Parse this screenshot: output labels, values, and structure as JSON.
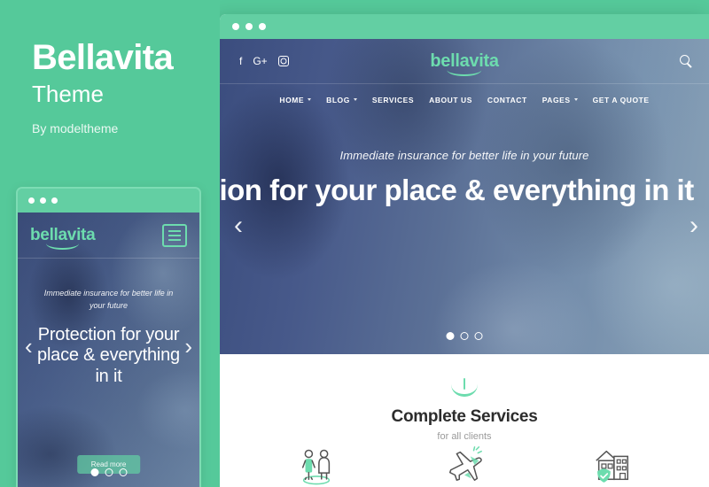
{
  "left_panel": {
    "brand_title": "Bellavita",
    "brand_subtitle": "Theme",
    "author": "By modeltheme"
  },
  "colors": {
    "brand_green": "#55c99a",
    "titlebar_green": "#63cfa3",
    "logo_green": "#6ddcae",
    "hero_navy": "#3b4d7e",
    "heading_dark": "#2c2c2c",
    "muted_gray": "#9a9a9a"
  },
  "mobile_mockup": {
    "window_dots": [
      "dot",
      "dot",
      "dot"
    ],
    "logo": "bellavita",
    "menu_icon": "hamburger-icon",
    "tagline": "Immediate insurance for better life in your future",
    "heading": "Protection for your place & everything in it",
    "cta_label": "Read more",
    "prev_arrow": "‹",
    "next_arrow": "›",
    "carousel_dots": 3,
    "active_dot": 0
  },
  "desktop_mockup": {
    "window_dots": [
      "dot",
      "dot",
      "dot"
    ],
    "logo": "bellavita",
    "search_icon": "search-icon",
    "social": [
      {
        "name": "facebook-icon",
        "glyph": "f"
      },
      {
        "name": "google-plus-icon",
        "glyph": "G+"
      },
      {
        "name": "instagram-icon",
        "glyph": ""
      }
    ],
    "nav": [
      {
        "label": "HOME",
        "has_dropdown": true
      },
      {
        "label": "BLOG",
        "has_dropdown": true
      },
      {
        "label": "SERVICES",
        "has_dropdown": false
      },
      {
        "label": "ABOUT US",
        "has_dropdown": false
      },
      {
        "label": "CONTACT",
        "has_dropdown": false
      },
      {
        "label": "PAGES",
        "has_dropdown": true
      },
      {
        "label": "GET A QUOTE",
        "has_dropdown": false
      }
    ],
    "tagline": "Immediate insurance for better life in your future",
    "heading": "Protection for your place & everything in it",
    "prev_arrow": "‹",
    "next_arrow": "›",
    "carousel_dots": 3,
    "active_dot": 0
  },
  "services": {
    "icon": "umbrella-icon",
    "title": "Complete Services",
    "subtitle": "for all clients",
    "cards": [
      {
        "icon": "family-people-icon"
      },
      {
        "icon": "airplane-travel-icon"
      },
      {
        "icon": "house-shield-icon"
      }
    ]
  }
}
